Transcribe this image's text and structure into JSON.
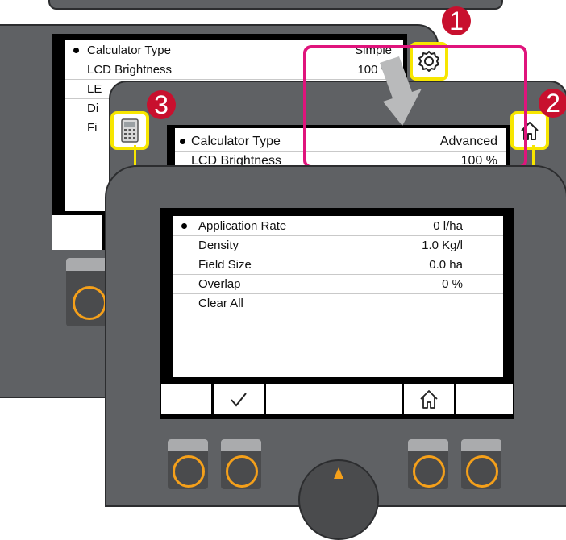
{
  "back_screen": {
    "rows": [
      {
        "label": "Calculator Type",
        "value": "Simple",
        "selected": true
      },
      {
        "label": "LCD Brightness",
        "value": "100 %"
      },
      {
        "label": "LE",
        "value": ""
      },
      {
        "label": "Di",
        "value": ""
      },
      {
        "label": "Fi",
        "value": ""
      }
    ],
    "settings_icon": "gear-icon"
  },
  "middle_screen": {
    "rows": [
      {
        "label": "Calculator Type",
        "value": "Advanced",
        "selected": true
      },
      {
        "label": "LCD Brightness",
        "value": "100 %"
      }
    ],
    "calculator_icon": "calculator-icon",
    "home_icon": "home-icon"
  },
  "front_screen": {
    "rows": [
      {
        "label": "Application Rate",
        "value": "0 l/ha",
        "selected": true
      },
      {
        "label": "Density",
        "value": "1.0 Kg/l"
      },
      {
        "label": "Field Size",
        "value": "0.0 ha"
      },
      {
        "label": "Overlap",
        "value": "0 %"
      },
      {
        "label": "Clear All",
        "value": ""
      }
    ],
    "softkeys": [
      "",
      "confirm-check-icon",
      "",
      "home-icon",
      ""
    ]
  },
  "callouts": {
    "one": "1",
    "two": "2",
    "three": "3"
  },
  "colors": {
    "callout": "#c8102e",
    "highlight_frame": "#e0147c",
    "icon_box": "#f7e600",
    "button_ring": "#f5a01a",
    "device_body": "#5f6164",
    "arrow": "#b9babb"
  }
}
